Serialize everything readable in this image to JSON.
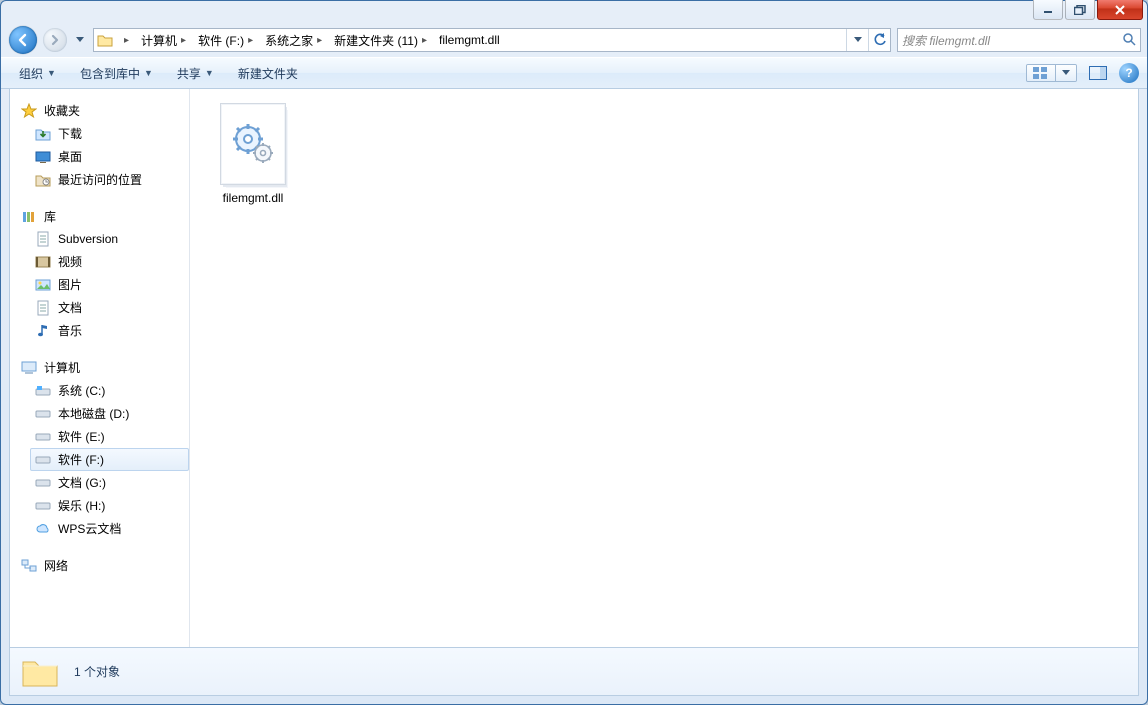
{
  "titlebar": {},
  "nav": {
    "breadcrumbs": [
      "计算机",
      "软件 (F:)",
      "系统之家",
      "新建文件夹 (11)",
      "filemgmt.dll"
    ]
  },
  "search": {
    "placeholder": "搜索 filemgmt.dll"
  },
  "toolbar": {
    "organize": "组织",
    "include": "包含到库中",
    "share": "共享",
    "newfolder": "新建文件夹"
  },
  "tree": {
    "favorites": {
      "title": "收藏夹",
      "items": [
        "下载",
        "桌面",
        "最近访问的位置"
      ]
    },
    "libraries": {
      "title": "库",
      "items": [
        "Subversion",
        "视频",
        "图片",
        "文档",
        "音乐"
      ]
    },
    "computer": {
      "title": "计算机",
      "items": [
        "系统 (C:)",
        "本地磁盘 (D:)",
        "软件 (E:)",
        "软件 (F:)",
        "文档 (G:)",
        "娱乐 (H:)",
        "WPS云文档"
      ],
      "selectedIndex": 3
    },
    "network": {
      "title": "网络"
    }
  },
  "content": {
    "files": [
      {
        "name": "filemgmt.dll"
      }
    ]
  },
  "status": {
    "text": "1 个对象"
  }
}
